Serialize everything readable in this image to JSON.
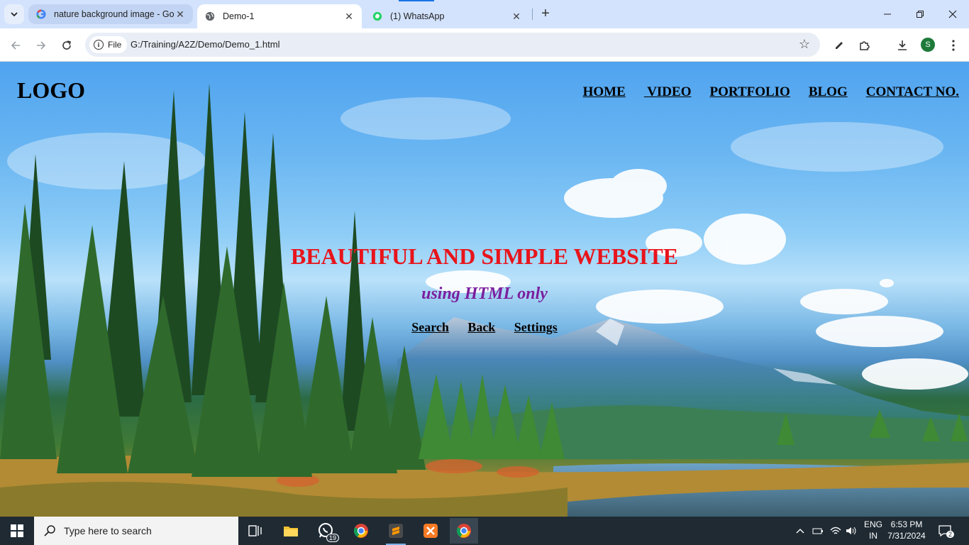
{
  "browser": {
    "tabs": [
      {
        "title": "nature background image - Go",
        "active": false,
        "favicon": "google-icon"
      },
      {
        "title": "Demo-1",
        "active": true,
        "favicon": "globe-icon"
      },
      {
        "title": "(1) WhatsApp",
        "active": false,
        "favicon": "whatsapp-icon"
      }
    ],
    "new_tab_label": "+",
    "chip_label": "File",
    "url": "G:/Training/A2Z/Demo/Demo_1.html",
    "profile_initial": "S"
  },
  "site": {
    "logo": "LOGO",
    "nav": [
      "HOME",
      " VIDEO",
      "PORTFOLIO",
      "BLOG",
      "CONTACT NO."
    ],
    "hero_title": "BEAUTIFUL AND SIMPLE WEBSITE",
    "hero_subtitle": "using HTML only",
    "hero_links": [
      "Search",
      "Back",
      "Settings"
    ],
    "colors": {
      "title": "#e8141b",
      "subtitle": "#7a1f9e"
    }
  },
  "taskbar": {
    "search_placeholder": "Type here to search",
    "whatsapp_badge": "19",
    "lang_line1": "ENG",
    "lang_line2": "IN",
    "time": "6:53 PM",
    "date": "7/31/2024",
    "notifications": "2"
  }
}
